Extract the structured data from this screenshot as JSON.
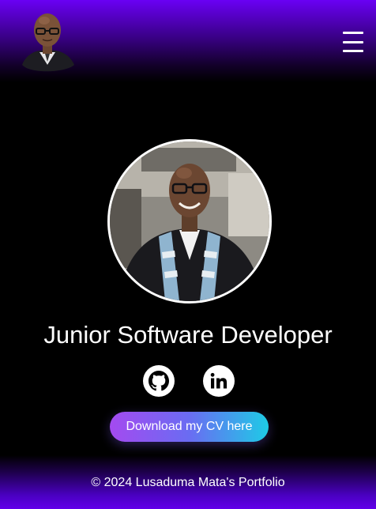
{
  "header": {
    "logo_icon": "profile-portrait",
    "menu_icon": "hamburger-menu-icon"
  },
  "hero": {
    "photo_icon": "graduation-portrait",
    "title": "Junior Software Developer",
    "socials": [
      {
        "name": "github",
        "icon": "github-icon"
      },
      {
        "name": "linkedin",
        "icon": "linkedin-icon"
      }
    ],
    "cv_button_label": "Download my CV here"
  },
  "footer": {
    "copyright": "© 2024 Lusaduma Mata's Portfolio"
  },
  "colors": {
    "header_purple": "#6a00f4",
    "footer_purple": "#6200ea",
    "button_start": "#a44af0",
    "button_end": "#1ecbe6",
    "background": "#000000"
  }
}
